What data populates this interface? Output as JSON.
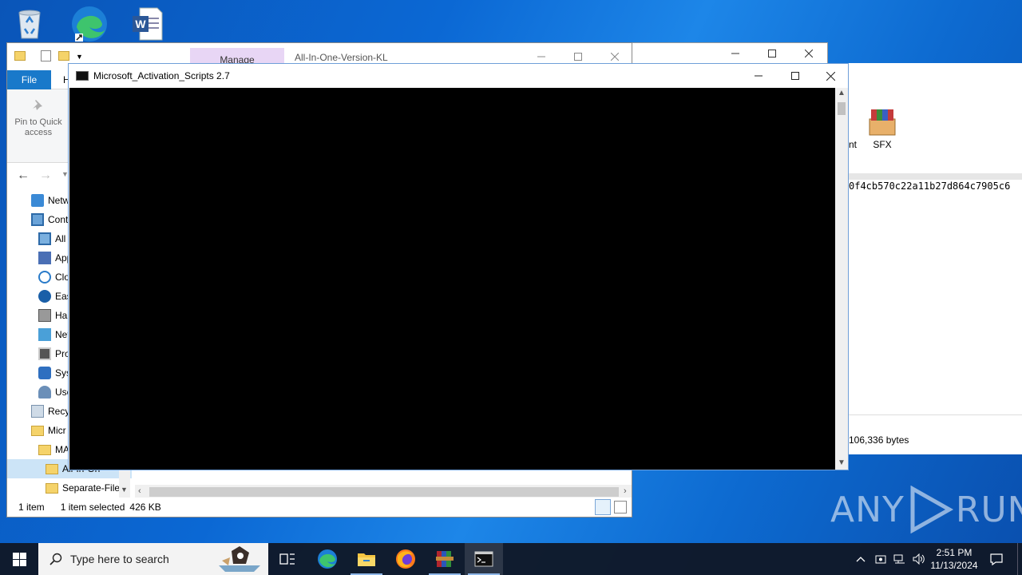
{
  "desktop": {
    "icons": [
      "recycle-bin-icon",
      "edge-icon",
      "word-icon"
    ]
  },
  "winrar": {
    "sfx_label": "SFX",
    "partial_label": "nt",
    "hash_text": "0f4cb570c22a11b27d864c7905c6",
    "size_text": "106,336 bytes"
  },
  "explorer": {
    "title": "All-In-One-Version-KL",
    "manage_tab": "Manage",
    "tabs": [
      "File",
      "H"
    ],
    "ribbon": {
      "pin_label_1": "Pin to Quick",
      "pin_label_2": "access"
    },
    "tree": [
      {
        "label": "Netw",
        "icon": "network-icon"
      },
      {
        "label": "Cont",
        "icon": "control-panel-icon"
      },
      {
        "label": "All",
        "icon": "all-items-icon"
      },
      {
        "label": "App",
        "icon": "apps-icon"
      },
      {
        "label": "Clo",
        "icon": "clock-icon"
      },
      {
        "label": "Eas",
        "icon": "ease-access-icon"
      },
      {
        "label": "Har",
        "icon": "hardware-icon"
      },
      {
        "label": "Net",
        "icon": "network-center-icon"
      },
      {
        "label": "Pro",
        "icon": "programs-icon"
      },
      {
        "label": "Sys",
        "icon": "system-icon"
      },
      {
        "label": "Use",
        "icon": "user-icon"
      },
      {
        "label": "Recy",
        "icon": "recycle-icon"
      },
      {
        "label": "Micr",
        "icon": "folder-icon"
      },
      {
        "label": "MA",
        "icon": "folder-icon"
      },
      {
        "label": "All-In-On",
        "icon": "folder-icon"
      },
      {
        "label": "Separate-File:",
        "icon": "folder-icon"
      }
    ],
    "status": {
      "count": "1 item",
      "selected": "1 item selected",
      "size": "426 KB"
    }
  },
  "cmd": {
    "title": "Microsoft_Activation_Scripts 2.7"
  },
  "taskbar": {
    "search_placeholder": "Type here to search",
    "time": "2:51 PM",
    "date": "11/13/2024"
  },
  "watermark": {
    "left": "ANY",
    "right": "RUN"
  }
}
